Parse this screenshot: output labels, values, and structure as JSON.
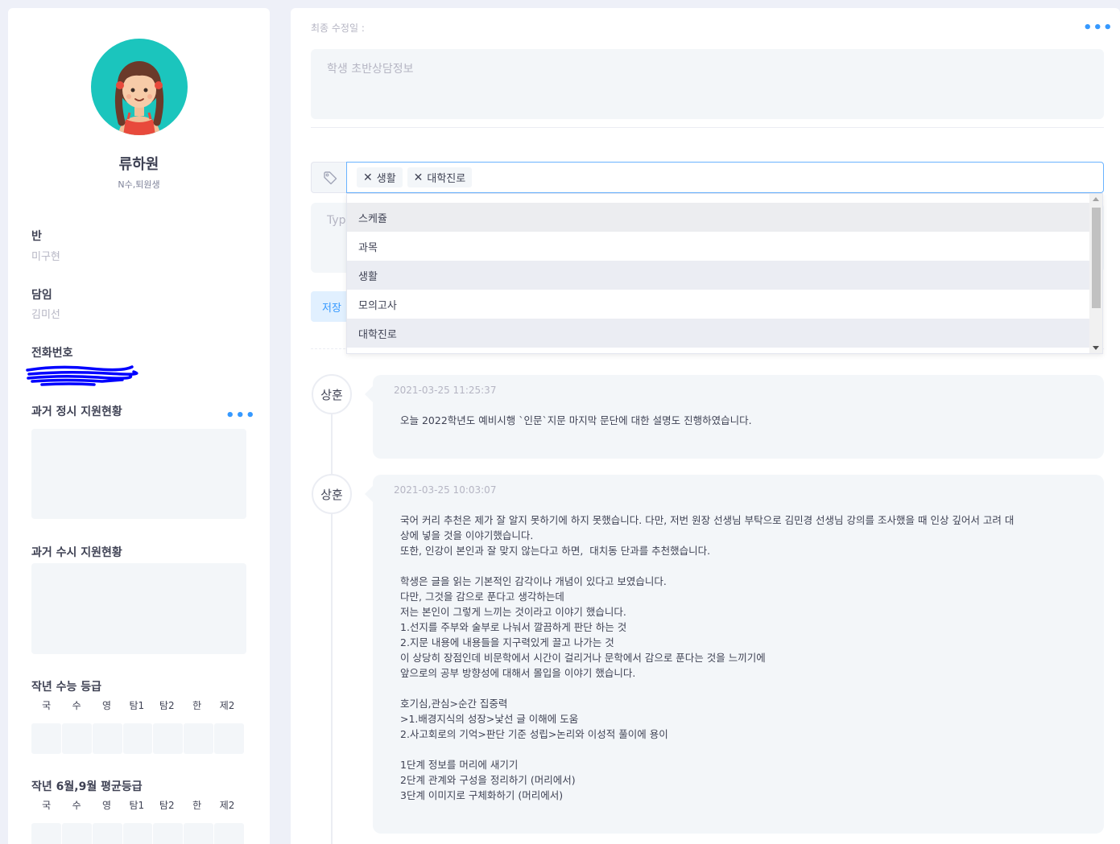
{
  "profile": {
    "name": "류하원",
    "subtitle": "N수,퇴원생",
    "class_label": "반",
    "class_value": "미구현",
    "teacher_label": "담임",
    "teacher_value": "김미선",
    "phone_label": "전화번호",
    "past_regular_label": "과거 정시 지원현황",
    "past_early_label": "과거 수시 지원현황",
    "csat_label": "작년 수능 등급",
    "mock_label": "작년 6월,9월 평균등급",
    "grade_columns": [
      "국",
      "수",
      "영",
      "탐1",
      "탐2",
      "한",
      "제2"
    ]
  },
  "main": {
    "last_modified": "최종 수정일 :",
    "consult_placeholder": "학생 초반상담정보",
    "tags": [
      "생활",
      "대학진로"
    ],
    "type_placeholder": "Type",
    "save_label": "저장",
    "dropdown_options": [
      "스케쥴",
      "과목",
      "생활",
      "모의고사",
      "대학진로"
    ]
  },
  "timeline": [
    {
      "author": "상훈",
      "date": "2021-03-25 11:25:37",
      "text": "오늘 2022학년도 예비시행 `인문`지문 마지막 문단에 대한 설명도 진행하였습니다."
    },
    {
      "author": "상훈",
      "date": "2021-03-25 10:03:07",
      "text": "국어 커리 추천은 제가 잘 알지 못하기에 하지 못했습니다. 다만, 저번 원장 선생님 부탁으로 김민경 선생님 강의를 조사했을 때 인상 깊어서 고려 대\n상에 넣을 것을 이야기했습니다.\n또한, 인강이 본인과 잘 맞지 않는다고 하면,  대치동 단과를 추천했습니다.\n\n학생은 글을 읽는 기본적인 감각이나 개념이 있다고 보였습니다.\n다만, 그것을 감으로 푼다고 생각하는데\n저는 본인이 그렇게 느끼는 것이라고 이야기 했습니다.\n1.선지를 주부와 술부로 나눠서 깔끔하게 판단 하는 것\n2.지문 내용에 내용들을 지구력있게 끌고 나가는 것\n이 상당히 장점인데 비문학에서 시간이 걸리거나 문학에서 감으로 푼다는 것을 느끼기에\n앞으로의 공부 방향성에 대해서 몰입을 이야기 했습니다.\n\n호기심,관심>순간 집중력\n>1.배경지식의 성장>낯선 글 이해에 도움\n2.사고회로의 기억>판단 기준 성립>논리와 이성적 풀이에 용이\n\n1단계 정보를 머리에 새기기\n2단계 관계와 구성을 정리하기 (머리에서)\n3단계 이미지로 구체화하기 (머리에서)"
    }
  ],
  "colors": {
    "accent": "#3699ff",
    "avatar_bg": "#1bc5bd",
    "scribble": "#0000ff"
  },
  "icons": [
    "avatar-girl-icon",
    "more-dots-icon",
    "tag-icon",
    "close-icon"
  ]
}
